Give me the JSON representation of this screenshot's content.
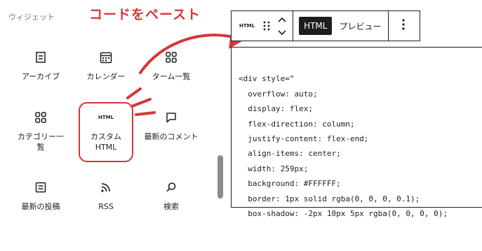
{
  "annotation": {
    "text": "コードをペースト"
  },
  "inserter": {
    "section_title": "ウィジェット",
    "items": [
      {
        "label": "アーカイブ",
        "icon": "archive-icon"
      },
      {
        "label": "カレンダー",
        "icon": "calendar-icon"
      },
      {
        "label": "ターム一覧",
        "icon": "tag-cloud-icon"
      },
      {
        "label": "カテゴリー一覧",
        "icon": "categories-icon"
      },
      {
        "label": "カスタムHTML",
        "icon": "html-icon",
        "icon_text": "HTML",
        "highlighted": true
      },
      {
        "label": "最新のコメント",
        "icon": "comment-icon"
      },
      {
        "label": "最新の投稿",
        "icon": "post-list-icon"
      },
      {
        "label": "RSS",
        "icon": "rss-icon"
      },
      {
        "label": "検索",
        "icon": "search-icon"
      }
    ]
  },
  "toolbar": {
    "block_icon_text": "HTML",
    "html_tab": "HTML",
    "preview_tab": "プレビュー"
  },
  "editor": {
    "lines": [
      "<div style=\"",
      "  overflow: auto;",
      "  display: flex;",
      "  flex-direction: column;",
      "  justify-content: flex-end;",
      "  align-items: center;",
      "  width: 259px;",
      "  background: #FFFFFF;",
      "  border: 1px solid rgba(0, 0, 0, 0.1);",
      "  box-shadow: -2px 10px 5px rgba(0, 0, 0, 0);"
    ]
  },
  "colors": {
    "accent": "#d63638",
    "text": "#1e1e1e",
    "muted": "#757575"
  }
}
